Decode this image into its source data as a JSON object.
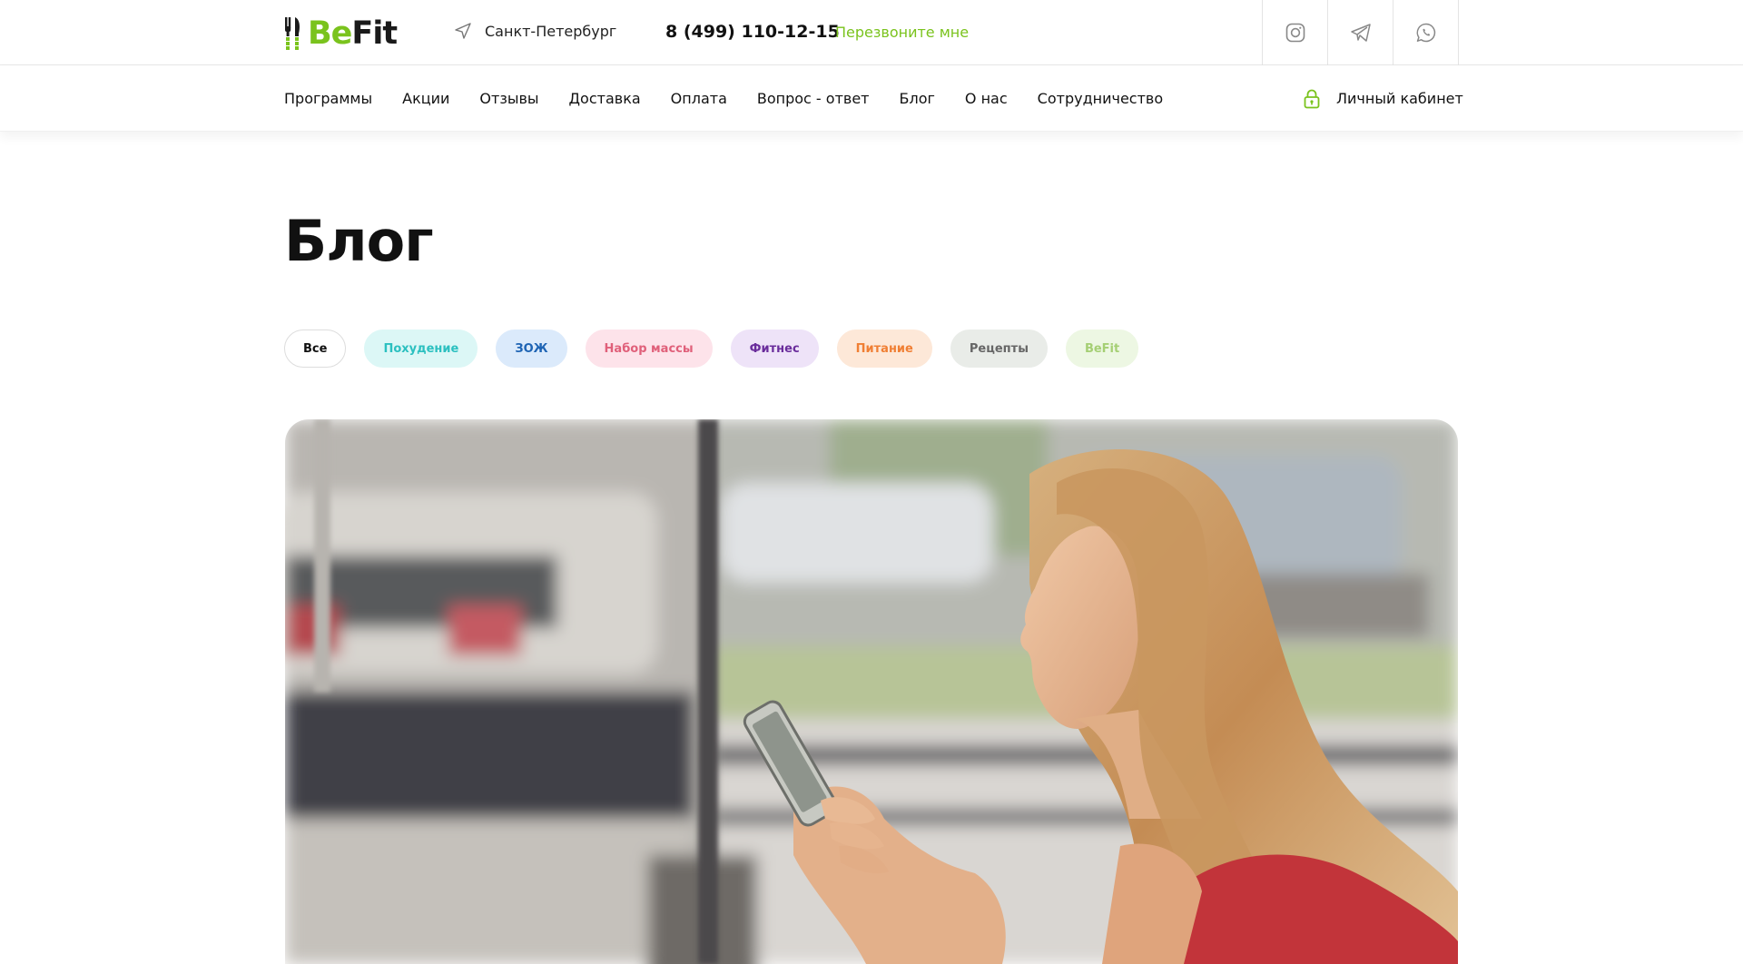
{
  "brand": {
    "logo_part1": "Be",
    "logo_part2": "Fit",
    "accent_color": "#7ac31d"
  },
  "header": {
    "city": "Санкт-Петербург",
    "phone": "8 (499) 110-12-15",
    "callback": "Перезвоните мне",
    "socials": [
      "instagram-icon",
      "telegram-icon",
      "whatsapp-icon"
    ]
  },
  "nav": {
    "items": [
      "Программы",
      "Акции",
      "Отзывы",
      "Доставка",
      "Оплата",
      "Вопрос - ответ",
      "Блог",
      "О нас",
      "Сотрудничество"
    ],
    "cabinet": "Личный кабинет"
  },
  "page": {
    "title": "Блог"
  },
  "filters": [
    {
      "label": "Все",
      "text_color": "#111111",
      "bg": "#ffffff",
      "border": "#dddddd",
      "active": true
    },
    {
      "label": "Похудение",
      "text_color": "#2cc0c0",
      "bg": "#dcf7f6",
      "border": "#dcf7f6",
      "active": false
    },
    {
      "label": "ЗОЖ",
      "text_color": "#1e64b4",
      "bg": "#dbeafb",
      "border": "#dbeafb",
      "active": false
    },
    {
      "label": "Набор массы",
      "text_color": "#e0607a",
      "bg": "#fde3ea",
      "border": "#fde3ea",
      "active": false
    },
    {
      "label": "Фитнес",
      "text_color": "#6a2d9c",
      "bg": "#eee3f8",
      "border": "#eee3f8",
      "active": false
    },
    {
      "label": "Питание",
      "text_color": "#f07f34",
      "bg": "#fde8d8",
      "border": "#fde8d8",
      "active": false
    },
    {
      "label": "Рецепты",
      "text_color": "#666666",
      "bg": "#e9ece8",
      "border": "#e9ece8",
      "active": false
    },
    {
      "label": "BeFit",
      "text_color": "#a5cf74",
      "bg": "#edf7e3",
      "border": "#edf7e3",
      "active": false
    }
  ]
}
